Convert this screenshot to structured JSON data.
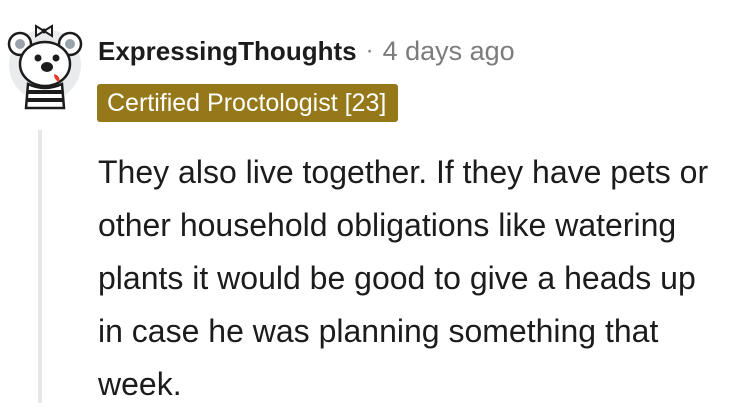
{
  "comment": {
    "author": "ExpressingThoughts",
    "separator": "·",
    "timestamp": "4 days ago",
    "flair": "Certified Proctologist [23]",
    "body": "They also live together. If they have pets or other household obligations like watering plants it would be good to give a heads up in case he was planning something that week.",
    "avatar_icon": "koala-avatar-icon",
    "flair_color": "#94781a"
  }
}
